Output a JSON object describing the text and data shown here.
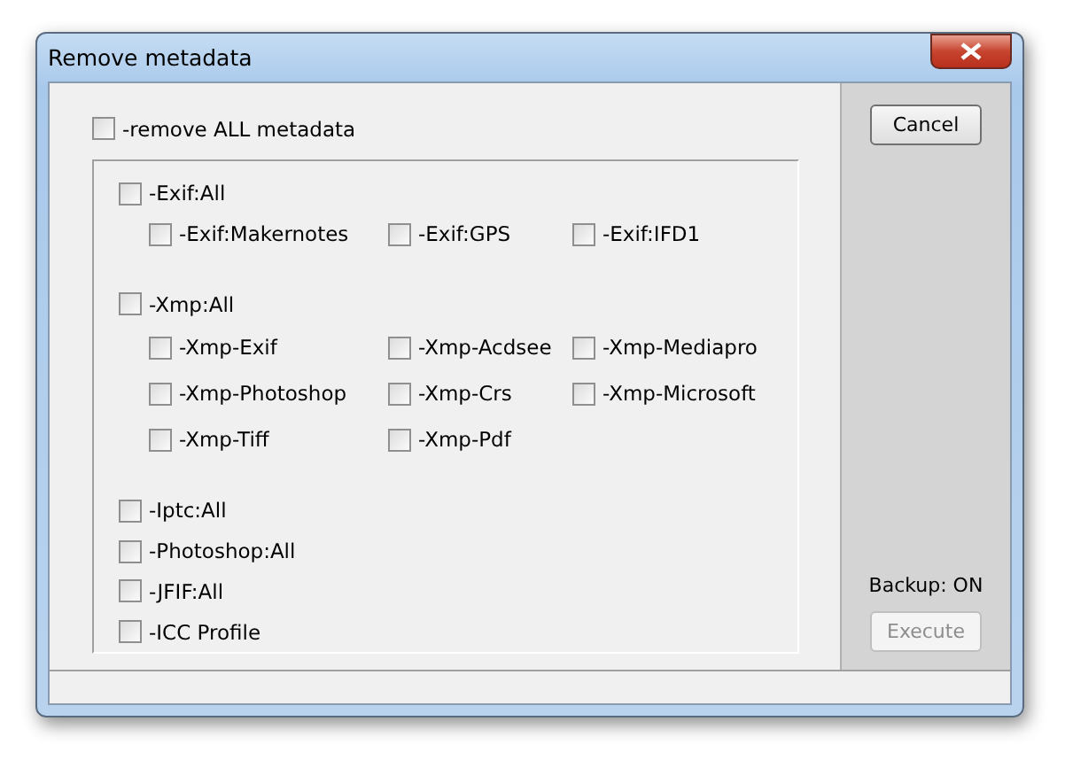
{
  "window": {
    "title": "Remove metadata"
  },
  "remove_all": {
    "label": "-remove ALL metadata",
    "checked": false
  },
  "groups": [
    {
      "label": "-Exif:All",
      "checked": false,
      "children": [
        {
          "label": "-Exif:Makernotes",
          "checked": false
        },
        {
          "label": "-Exif:GPS",
          "checked": false
        },
        {
          "label": "-Exif:IFD1",
          "checked": false
        }
      ]
    },
    {
      "label": "-Xmp:All",
      "checked": false,
      "children": [
        {
          "label": "-Xmp-Exif",
          "checked": false
        },
        {
          "label": "-Xmp-Acdsee",
          "checked": false
        },
        {
          "label": "-Xmp-Mediapro",
          "checked": false
        },
        {
          "label": "-Xmp-Photoshop",
          "checked": false
        },
        {
          "label": "-Xmp-Crs",
          "checked": false
        },
        {
          "label": "-Xmp-Microsoft",
          "checked": false
        },
        {
          "label": "-Xmp-Tiff",
          "checked": false
        },
        {
          "label": "-Xmp-Pdf",
          "checked": false
        }
      ]
    }
  ],
  "singles": [
    {
      "label": "-Iptc:All",
      "checked": false
    },
    {
      "label": "-Photoshop:All",
      "checked": false
    },
    {
      "label": "-JFIF:All",
      "checked": false
    },
    {
      "label": "-ICC Profile",
      "checked": false
    }
  ],
  "buttons": {
    "cancel": {
      "label": "Cancel",
      "disabled": false
    },
    "execute": {
      "label": "Execute",
      "disabled": true
    }
  },
  "backup_status": "Backup: ON"
}
